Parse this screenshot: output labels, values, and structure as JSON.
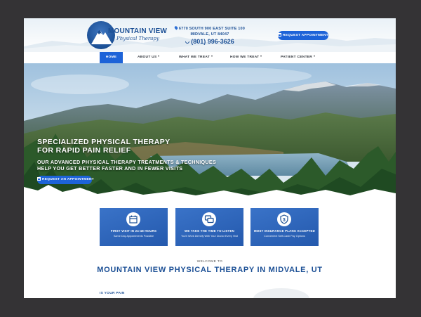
{
  "logo": {
    "name": "MOUNTAIN VIEW",
    "sub": "Physical Therapy"
  },
  "contact": {
    "address_line1": "6770 SOUTH 900 EAST SUITE 100",
    "address_line2": "MIDVALE, UT 84047",
    "phone": "(801) 996-3626"
  },
  "header_cta": "REQUEST APPOINTMENT",
  "nav": [
    {
      "label": "HOME",
      "active": true
    },
    {
      "label": "ABOUT US",
      "dropdown": true
    },
    {
      "label": "WHAT WE TREAT",
      "dropdown": true
    },
    {
      "label": "HOW WE TREAT",
      "dropdown": true
    },
    {
      "label": "PATIENT CENTER",
      "dropdown": true
    }
  ],
  "hero": {
    "title_line1": "SPECIALIZED PHYSICAL THERAPY",
    "title_line2": "FOR RAPID PAIN RELIEF",
    "sub_line1": "OUR ADVANCED PHYSICAL THERAPY TREATMENTS & TECHNIQUES",
    "sub_line2": "HELP YOU GET BETTER FASTER AND IN FEWER VISITS",
    "cta": "REQUEST AN APPOINTMENT"
  },
  "cards": [
    {
      "icon": "calendar-icon",
      "title": "FIRST VISIT IN 24-48 HOURS",
      "sub": "Same Day Appointments Possible"
    },
    {
      "icon": "chat-icon",
      "title": "WE TAKE THE TIME TO LISTEN",
      "sub": "You'll Work Directly With Your Doctor Every Visit"
    },
    {
      "icon": "shield-dollar-icon",
      "title": "MOST INSURANCE PLANS ACCEPTED",
      "sub": "Convenient Self-Cash Pay Options"
    }
  ],
  "welcome": "WELCOME TO",
  "main_title": "MOUNTAIN VIEW PHYSICAL THERAPY IN MIDVALE, UT",
  "section_label": "IS YOUR PAIN",
  "colors": {
    "primary": "#1d63d8",
    "brand_navy": "#1b4f95",
    "card": "#2f68be",
    "backdrop": "#343335"
  }
}
